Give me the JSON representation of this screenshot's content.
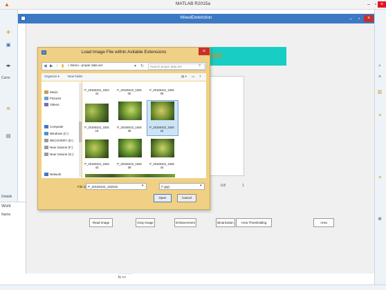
{
  "matlab": {
    "title": "MATLAB R2015a",
    "logo": "matlab-logo-icon",
    "side_labels": {
      "current": "Curre",
      "details": "Details",
      "workspace": "Work",
      "name": "Name"
    },
    "command_prompt": "fx >>",
    "command_hint": "... ..........."
  },
  "figure": {
    "title": "WeedDetetction",
    "banner_text": "tion",
    "axis": {
      "x_ticks": [
        "0.8",
        "1"
      ]
    },
    "buttons": [
      {
        "label": "Read Image"
      },
      {
        "label": "Gray Image"
      },
      {
        "label": "Enhancement"
      },
      {
        "label": "Binarization"
      },
      {
        "label": "Area Thresholding"
      },
      {
        "label": "Area"
      }
    ]
  },
  "dialog": {
    "title": "Load Image File within Avilable Extensions",
    "breadcrumb": "« Demo  ›  proper data set",
    "search_placeholder": "Search proper data set",
    "organize_label": "Organize ▾",
    "new_folder_label": "New folder",
    "nav_items": [
      {
        "label": "Music",
        "icon": "music-folder-icon"
      },
      {
        "label": "Pictures",
        "icon": "pictures-folder-icon"
      },
      {
        "label": "Videos",
        "icon": "videos-folder-icon"
      },
      {
        "label": "Computer",
        "icon": "computer-icon"
      },
      {
        "label": "Windows (C:)",
        "icon": "drive-icon"
      },
      {
        "label": "RECOVERY (D:)",
        "icon": "drive-icon"
      },
      {
        "label": "New Volume (F:)",
        "icon": "drive-icon"
      },
      {
        "label": "New Volume (G:)",
        "icon": "drive-icon"
      },
      {
        "label": "Network",
        "icon": "network-icon"
      }
    ],
    "files": [
      {
        "name": "P_20160422_1623\n43",
        "has_thumb": false
      },
      {
        "name": "P_20160422_1625\n00",
        "has_thumb": false
      },
      {
        "name": "P_20160422_1625\n09",
        "has_thumb": false
      },
      {
        "name": "P_20160422_1625\n19",
        "has_thumb": true
      },
      {
        "name": "P_20160422_1625\n38",
        "has_thumb": true
      },
      {
        "name": "P_20160422_1626\n15",
        "has_thumb": true,
        "selected": true
      },
      {
        "name": "P_20160422_1626\n43",
        "has_thumb": true
      },
      {
        "name": "P_20160422_1628\n38",
        "has_thumb": true
      },
      {
        "name": "P_20160422_1628\n44",
        "has_thumb": true
      }
    ],
    "filename_label": "File name:",
    "filename_value": "P_20160422_162615",
    "filetype_value": "(*.jpg)",
    "open_label": "Open",
    "cancel_label": "Cancel"
  },
  "colors": {
    "banner": "#18cdc3",
    "banner_text": "#ff7a00",
    "dialog_frame": "#f0d084",
    "figure_titlebar": "#3b79c4"
  }
}
